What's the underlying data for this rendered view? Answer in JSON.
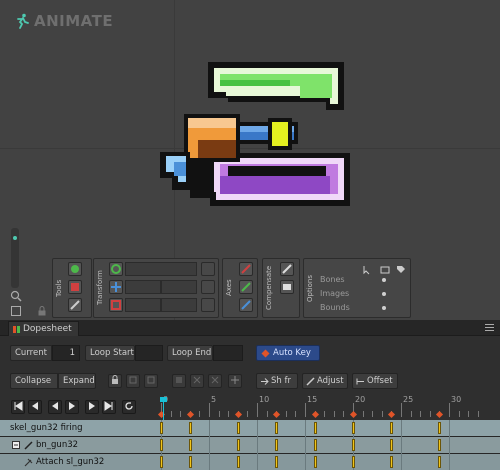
{
  "app": {
    "logo_text": "ANIMATE"
  },
  "panels": {
    "tools": {
      "label": "Tools"
    },
    "transform": {
      "label": "Transform"
    },
    "axes": {
      "label": "Axes"
    },
    "compensate": {
      "label": "Compensate"
    },
    "options": {
      "label": "Options",
      "items": [
        "Bones",
        "Images",
        "Bounds"
      ]
    }
  },
  "dopesheet": {
    "tab_label": "Dopesheet",
    "current_label": "Current",
    "current_value": "1",
    "loop_start_label": "Loop Start",
    "loop_end_label": "Loop End",
    "auto_key_label": "Auto Key",
    "collapse_label": "Collapse",
    "expand_label": "Expand",
    "shift_label": "Sh fr",
    "adjust_label": "Adjust",
    "offset_label": "Offset",
    "ruler_labels": [
      "0",
      "5",
      "10",
      "15",
      "20",
      "25",
      "30"
    ],
    "tracks": [
      {
        "name": "skel_gun32 firing",
        "level": 0
      },
      {
        "name": "bn_gun32",
        "level": 1
      },
      {
        "name": "Attach sl_gun32",
        "level": 2
      }
    ]
  },
  "colors": {
    "accent": "#19c0d6",
    "autokey": "#2c4a8a",
    "key": "#f0c419",
    "diamond": "#e05428"
  }
}
